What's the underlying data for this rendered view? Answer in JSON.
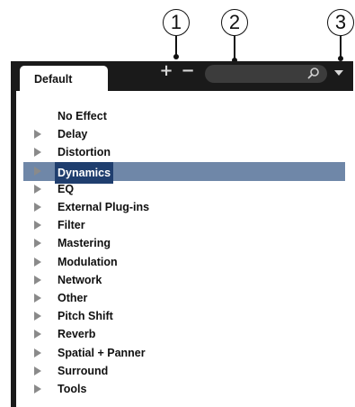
{
  "callouts": [
    "1",
    "2",
    "3"
  ],
  "tabs": {
    "active": "Default"
  },
  "toolbar": {
    "add_label": "+",
    "remove_label": "−",
    "search": {
      "value": "",
      "icon": "search-icon"
    },
    "menu_icon": "dropdown-arrow-icon"
  },
  "tree": {
    "items": [
      {
        "label": "No Effect",
        "expandable": false,
        "selected": false
      },
      {
        "label": "Delay",
        "expandable": true,
        "selected": false
      },
      {
        "label": "Distortion",
        "expandable": true,
        "selected": false
      },
      {
        "label": "Dynamics",
        "expandable": true,
        "selected": true
      },
      {
        "label": "EQ",
        "expandable": true,
        "selected": false
      },
      {
        "label": "External Plug-ins",
        "expandable": true,
        "selected": false
      },
      {
        "label": "Filter",
        "expandable": true,
        "selected": false
      },
      {
        "label": "Mastering",
        "expandable": true,
        "selected": false
      },
      {
        "label": "Modulation",
        "expandable": true,
        "selected": false
      },
      {
        "label": "Network",
        "expandable": true,
        "selected": false
      },
      {
        "label": "Other",
        "expandable": true,
        "selected": false
      },
      {
        "label": "Pitch Shift",
        "expandable": true,
        "selected": false
      },
      {
        "label": "Reverb",
        "expandable": true,
        "selected": false
      },
      {
        "label": "Spatial + Panner",
        "expandable": true,
        "selected": false
      },
      {
        "label": "Surround",
        "expandable": true,
        "selected": false
      },
      {
        "label": "Tools",
        "expandable": true,
        "selected": false
      }
    ]
  },
  "colors": {
    "panel_bg": "#1a1a1a",
    "selection_row": "#6f87a8",
    "selection_label": "#1f3e6e"
  }
}
